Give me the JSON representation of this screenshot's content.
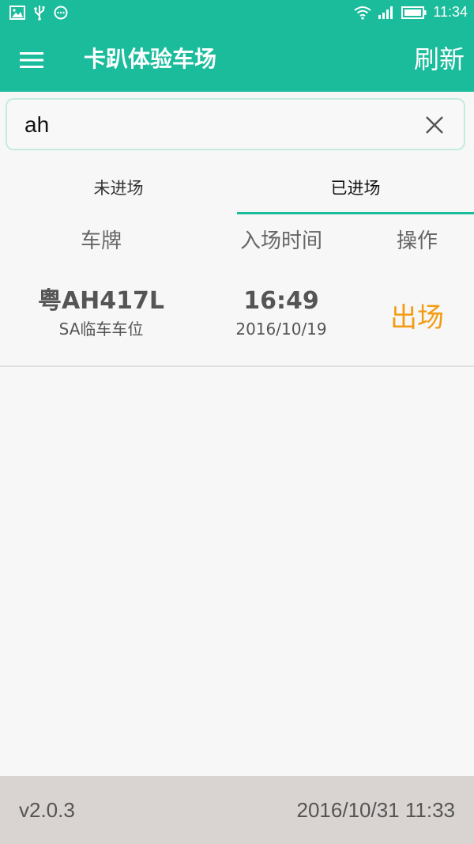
{
  "status_bar": {
    "time": "11:34",
    "left_icons": [
      "image-icon",
      "usb-icon",
      "message-icon"
    ],
    "right_icons": [
      "wifi-icon",
      "signal-icon",
      "battery-icon"
    ]
  },
  "app_bar": {
    "title": "卡趴体验车场",
    "refresh_label": "刷新",
    "menu_icon": "menu-icon"
  },
  "search": {
    "value": "ah",
    "placeholder": ""
  },
  "tabs": [
    {
      "label": "未进场",
      "active": false
    },
    {
      "label": "已进场",
      "active": true
    }
  ],
  "table": {
    "headers": [
      "车牌",
      "入场时间",
      "操作"
    ],
    "rows": [
      {
        "plate": "粤AH417L",
        "space": "SA临车车位",
        "time": "16:49",
        "date": "2016/10/19",
        "action": "出场"
      }
    ]
  },
  "footer": {
    "version": "v2.0.3",
    "datetime": "2016/10/31 11:33"
  },
  "colors": {
    "primary": "#1abc9c",
    "action": "#f39c12",
    "footer_bg": "#d9d4d1"
  }
}
